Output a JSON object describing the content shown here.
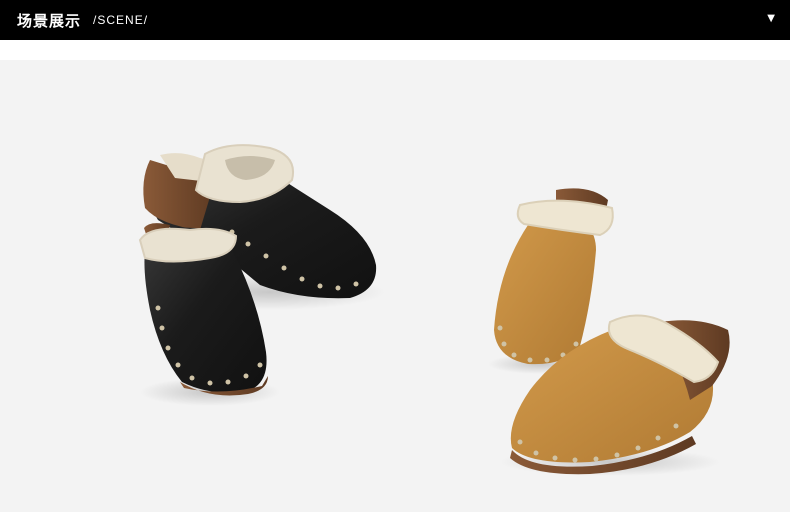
{
  "header": {
    "title": "场景展示",
    "subtitle": "/SCENE/",
    "toggle_symbol": "▼"
  },
  "scene": {
    "background": "#f3f3f3",
    "products": [
      {
        "name": "black-leather-shearling-clog",
        "color": "#1c1c1c",
        "sole_color": "#7a4f32"
      },
      {
        "name": "tan-suede-shearling-clog",
        "color": "#c08a3e",
        "sole_color": "#7a4f32"
      }
    ]
  }
}
